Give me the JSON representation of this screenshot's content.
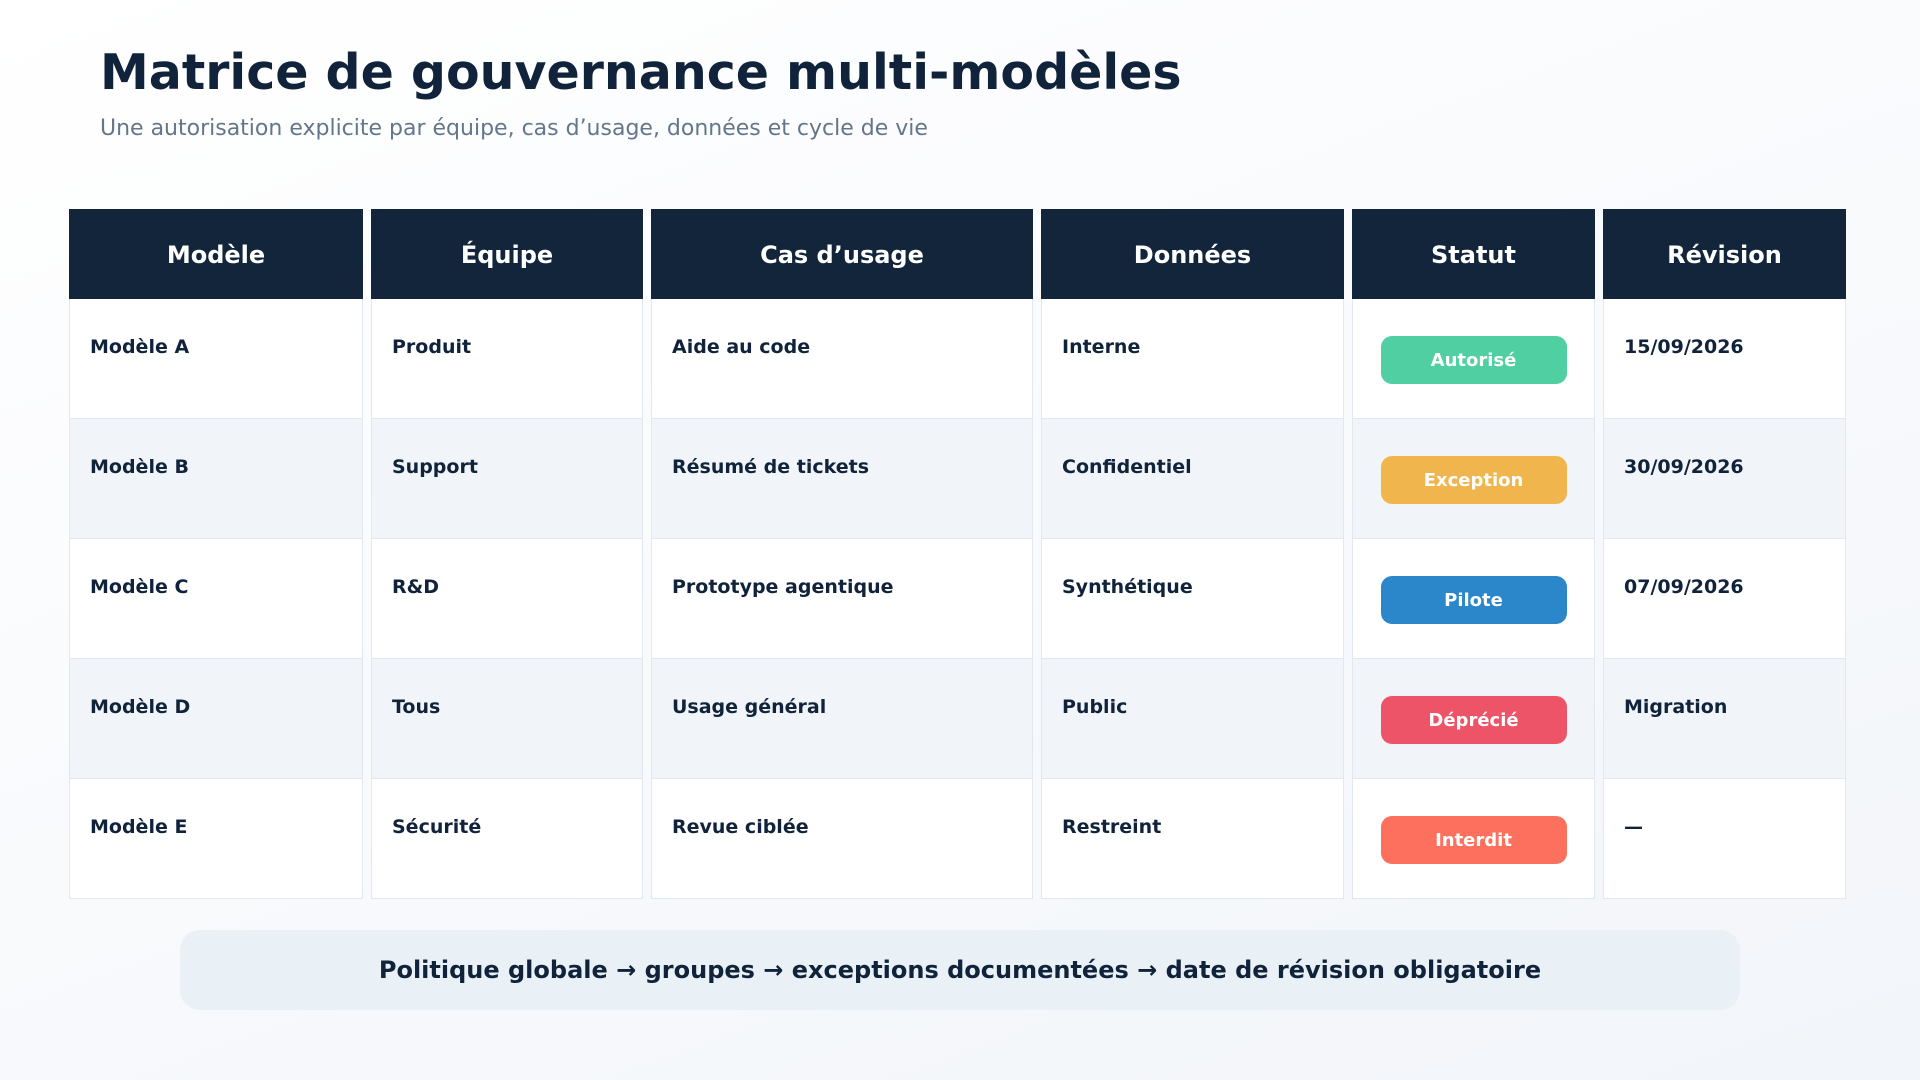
{
  "header": {
    "title": "Matrice de gouvernance multi-modèles",
    "subtitle": "Une autorisation explicite par équipe, cas d’usage, données et cycle de vie"
  },
  "table": {
    "columns": [
      "Modèle",
      "Équipe",
      "Cas d’usage",
      "Données",
      "Statut",
      "Révision"
    ],
    "rows": [
      {
        "model": "Modèle A",
        "team": "Produit",
        "use_case": "Aide au code",
        "data": "Interne",
        "status": "Autorisé",
        "status_color": "#50cfa2",
        "revision": "15/09/2026"
      },
      {
        "model": "Modèle B",
        "team": "Support",
        "use_case": "Résumé de tickets",
        "data": "Confidentiel",
        "status": "Exception",
        "status_color": "#f0b54d",
        "revision": "30/09/2026"
      },
      {
        "model": "Modèle C",
        "team": "R&D",
        "use_case": "Prototype agentique",
        "data": "Synthétique",
        "status": "Pilote",
        "status_color": "#2b87ca",
        "revision": "07/09/2026"
      },
      {
        "model": "Modèle D",
        "team": "Tous",
        "use_case": "Usage général",
        "data": "Public",
        "status": "Déprécié",
        "status_color": "#ee5468",
        "revision": "Migration"
      },
      {
        "model": "Modèle E",
        "team": "Sécurité",
        "use_case": "Revue ciblée",
        "data": "Restreint",
        "status": "Interdit",
        "status_color": "#fd705e",
        "revision": "—"
      }
    ]
  },
  "footer": {
    "text": "Politique globale → groupes → exceptions documentées → date de révision obligatoire"
  },
  "colors": {
    "header_bg": "#12253b",
    "row_alt_bg": "#f1f5f9",
    "footer_bg": "#e9f0f6"
  }
}
